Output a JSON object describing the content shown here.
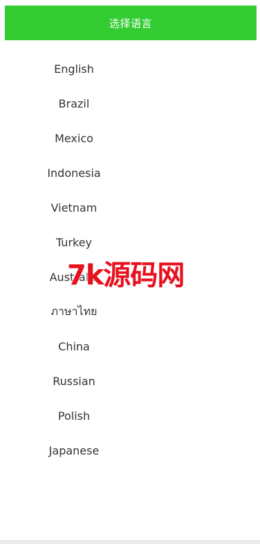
{
  "header": {
    "title": "选择语言"
  },
  "languages": [
    {
      "label": "English"
    },
    {
      "label": "Brazil"
    },
    {
      "label": "Mexico"
    },
    {
      "label": "Indonesia"
    },
    {
      "label": "Vietnam"
    },
    {
      "label": "Turkey"
    },
    {
      "label": "Australia"
    },
    {
      "label": "ภาษาไทย"
    },
    {
      "label": "China"
    },
    {
      "label": "Russian"
    },
    {
      "label": "Polish"
    },
    {
      "label": "Japanese"
    }
  ],
  "watermark": {
    "text": "7k源码网"
  },
  "colors": {
    "header_bg": "#33cc33",
    "header_text": "#ffffff",
    "item_text": "#333333",
    "watermark": "#e8101e"
  }
}
